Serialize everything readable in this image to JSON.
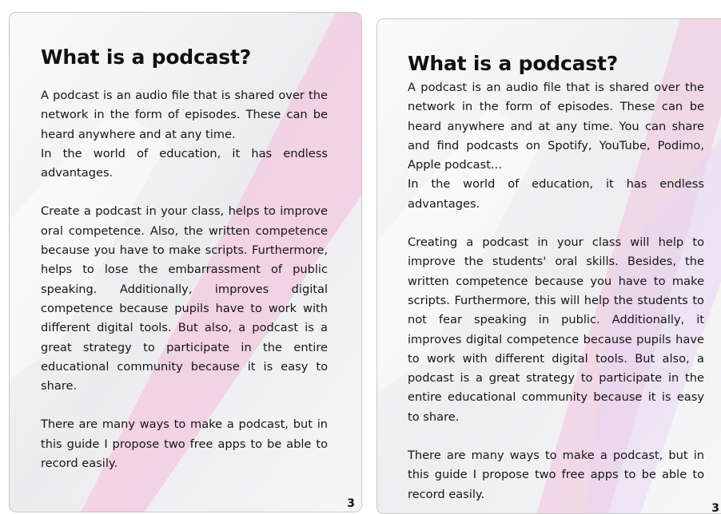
{
  "pages": [
    {
      "title": "What is a podcast?",
      "paragraphs": [
        "A podcast is an audio file that is shared over the network in the form of episodes. These can be heard anywhere and at any time.\nIn the world of education, it has endless advantages.",
        "Create a podcast in your class, helps to improve oral competence. Also, the written competence because you have to make scripts. Furthermore, helps to lose the embarrassment of public speaking. Additionally, improves digital competence because pupils have to work with different digital tools. But also, a podcast is a great strategy to participate in the entire educational community because it is easy to share.",
        "There are many ways to make a podcast, but in this guide I propose two free apps to be able to record easily."
      ],
      "page_number": "3"
    },
    {
      "title": "What is a podcast?",
      "paragraphs": [
        "A podcast is an audio file that is shared over the network in the form of episodes. These can be heard anywhere and at any time. You can share and find podcasts on Spotify, YouTube, Podimo, Apple podcast...\nIn the world of education, it has endless advantages.",
        "Creating a podcast in your class will help to improve the students' oral skills. Besides, the written competence because you have to make scripts. Furthermore, this will help the students to not fear speaking in public. Additionally, it improves digital competence because pupils have to work with different digital tools. But also, a podcast is a great strategy to participate in the entire educational community because it is easy to share.",
        "There are many ways to make a podcast, but in this guide I propose two free apps to be able to record easily."
      ],
      "page_number": "3"
    }
  ],
  "colors": {
    "stripe_pink": "#f2c9dd",
    "stripe_lavender": "#e6d6f4",
    "page_bg": "#f1f1f3",
    "border": "#c8c8c8"
  }
}
